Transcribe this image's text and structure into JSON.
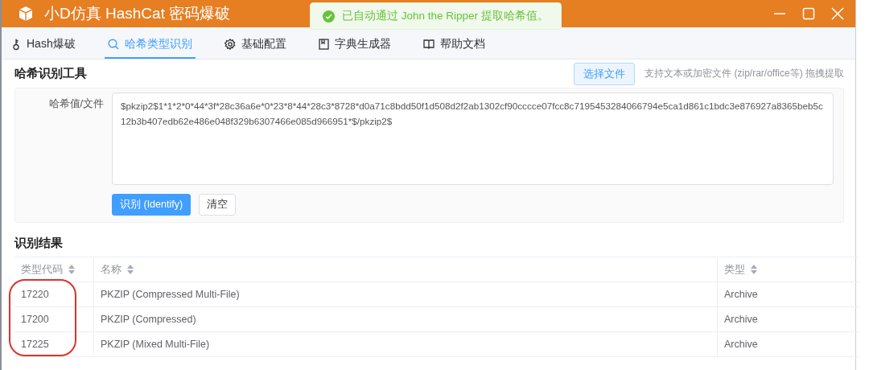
{
  "window": {
    "title": "小D仿真 HashCat 密码爆破"
  },
  "toast": {
    "kind": "success",
    "message": "已自动通过 John the Ripper 提取哈希值。"
  },
  "tabs": [
    {
      "label": "Hash爆破",
      "selected": false
    },
    {
      "label": "哈希类型识别",
      "selected": true
    },
    {
      "label": "基础配置",
      "selected": false
    },
    {
      "label": "字典生成器",
      "selected": false
    },
    {
      "label": "帮助文档",
      "selected": false
    }
  ],
  "tool": {
    "title": "哈希识别工具",
    "choose_button": "选择文件",
    "hint": "支持文本或加密文件 (zip/rar/office等) 拖拽提取",
    "field_label": "哈希值/文件",
    "value": "$pkzip2$1*1*2*0*44*3f*28c36a6e*0*23*8*44*28c3*8728*d0a71c8bdd50f1d508d2f2ab1302cf90cccce07fcc8c7195453284066794e5ca1d861c1bdc3e876927a8365beb5c12b3b407edb62e486e048f329b6307466e085d966951*$/pkzip2$",
    "buttons": [
      {
        "label": "识别 (Identify)",
        "kind": "primary"
      },
      {
        "label": "清空",
        "kind": "default"
      }
    ]
  },
  "results": {
    "title": "识别结果",
    "columns": [
      "类型代码",
      "名称",
      "类型"
    ],
    "rows": [
      [
        "17220",
        "PKZIP (Compressed Multi-File)",
        "Archive"
      ],
      [
        "17200",
        "PKZIP (Compressed)",
        "Archive"
      ],
      [
        "17225",
        "PKZIP (Mixed Multi-File)",
        "Archive"
      ]
    ],
    "annotation": {
      "kind": "oval"
    }
  }
}
